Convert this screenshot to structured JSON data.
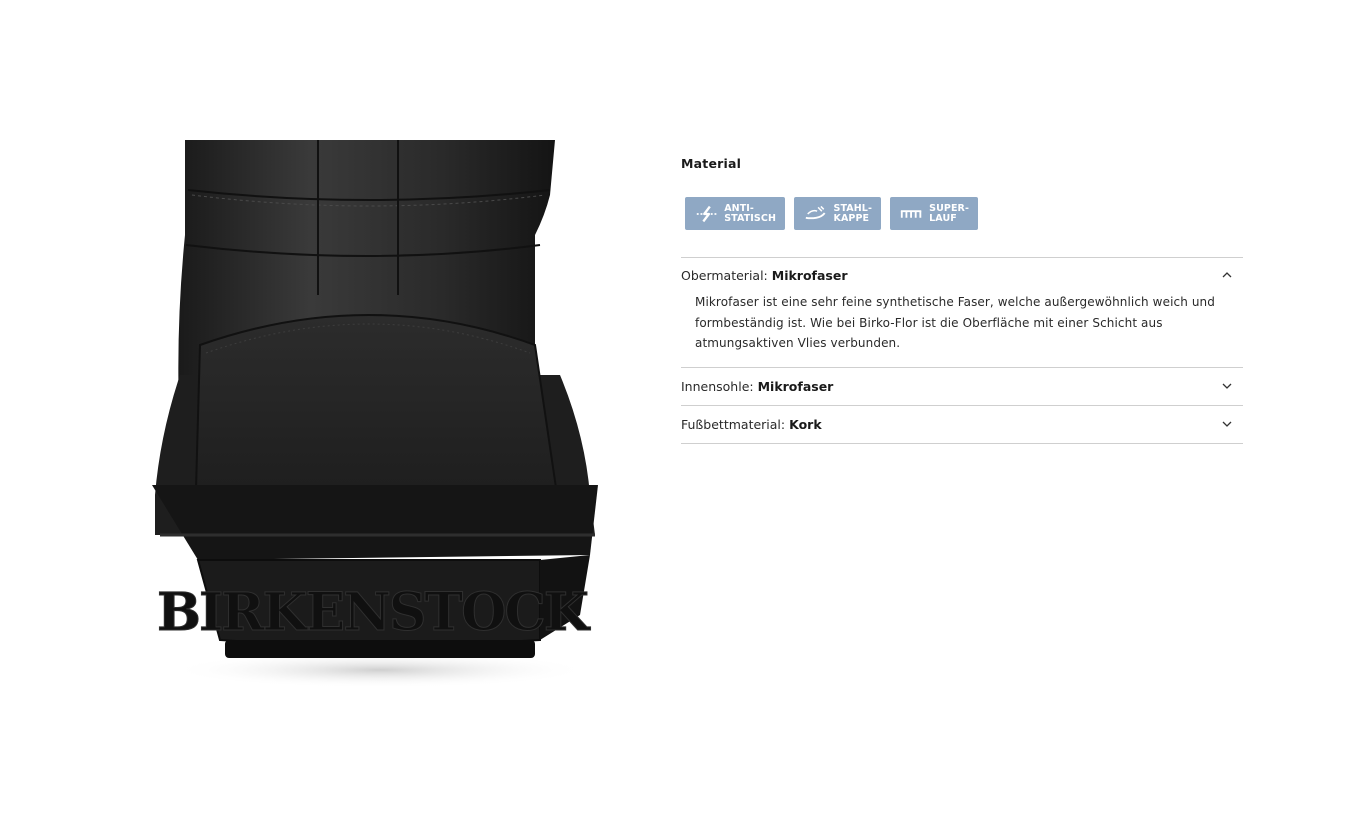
{
  "image": {
    "alt": "BIRKENSTOCK boot rear view",
    "brand_embossing": "BIRKENSTOCK"
  },
  "material": {
    "title": "Material",
    "badges": [
      {
        "icon": "antistatic-icon",
        "line1": "ANTI-",
        "line2": "STATISCH"
      },
      {
        "icon": "steel-toe-icon",
        "line1": "STAHL-",
        "line2": "KAPPE"
      },
      {
        "icon": "super-grip-icon",
        "line1": "SUPER-",
        "line2": "LAUF"
      }
    ],
    "badge_color": "#8fa8c4",
    "items": [
      {
        "key": "Obermaterial:",
        "value": "Mikrofaser",
        "expanded": true,
        "description": "Mikrofaser ist eine sehr feine synthetische Faser, welche außergewöhnlich weich und formbeständig ist. Wie bei Birko-Flor ist die Oberfläche mit einer Schicht aus atmungsaktiven Vlies verbunden."
      },
      {
        "key": "Innensohle:",
        "value": "Mikrofaser",
        "expanded": false
      },
      {
        "key": "Fußbettmaterial:",
        "value": "Kork",
        "expanded": false
      }
    ]
  }
}
